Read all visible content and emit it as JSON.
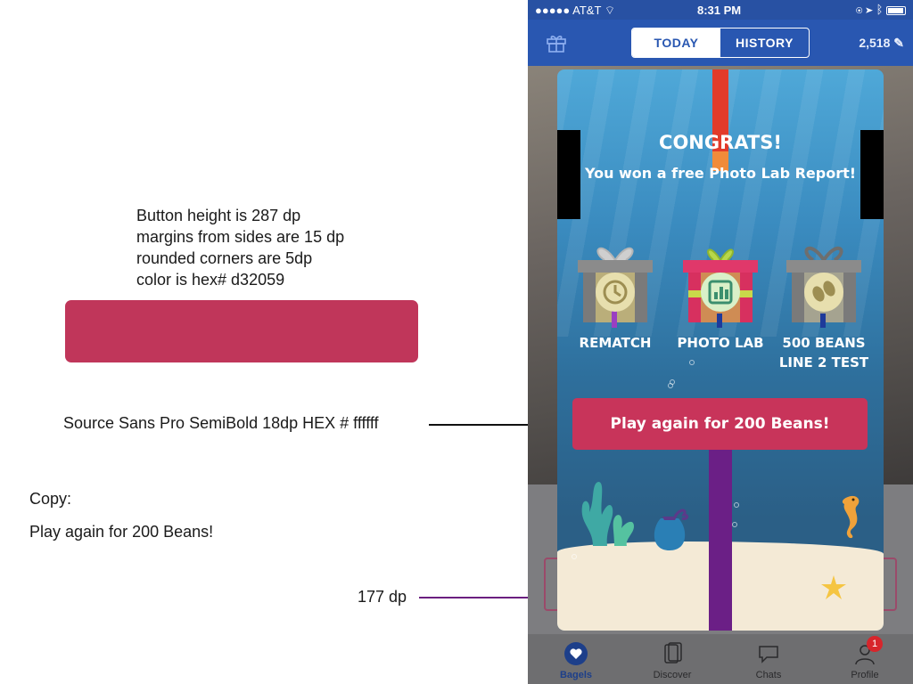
{
  "annotations": {
    "spec_lines": [
      "Button height is 287 dp",
      "margins from sides are 15 dp",
      "rounded corners are 5dp",
      "color is hex# d32059"
    ],
    "font_note": "Source Sans Pro SemiBold 18dp HEX # ffffff",
    "copy_label": "Copy:",
    "copy_text": "Play again for 200 Beans!",
    "height_note": "177 dp"
  },
  "status_bar": {
    "carrier": "●●●●● AT&T",
    "time": "8:31 PM"
  },
  "nav": {
    "tab_today": "TODAY",
    "tab_history": "HISTORY",
    "beans_count": "2,518"
  },
  "modal": {
    "title": "CONGRATS!",
    "subtitle": "You won a free Photo Lab Report!",
    "prizes": [
      {
        "label_line1": "REMATCH",
        "label_line2": "",
        "icon": "history-icon"
      },
      {
        "label_line1": "PHOTO LAB",
        "label_line2": "",
        "icon": "chart-icon"
      },
      {
        "label_line1": "500 BEANS",
        "label_line2": "LINE 2 TEST",
        "icon": "beans-icon"
      }
    ],
    "play_button": "Play again for 200 Beans!"
  },
  "tabbar": {
    "items": [
      "Bagels",
      "Discover",
      "Chats",
      "Profile"
    ],
    "profile_badge": "1"
  },
  "colors": {
    "button": "#c8345a",
    "nav_blue": "#2957b1",
    "purple_marker": "#6b1f86"
  }
}
